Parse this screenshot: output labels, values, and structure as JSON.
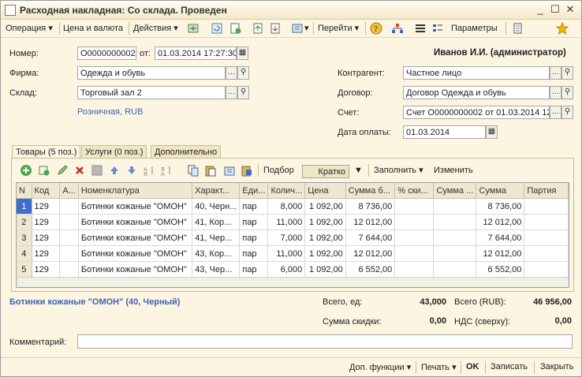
{
  "window": {
    "title": "Расходная накладная: Со склада. Проведен"
  },
  "toolbar": {
    "operation": "Операция",
    "price_currency": "Цена и валюта",
    "actions": "Действия",
    "goto": "Перейти",
    "params": "Параметры"
  },
  "header": {
    "number_label": "Номер:",
    "number_value": "О0000000002",
    "from_label": "от:",
    "date_value": "01.03.2014 17:27:30",
    "user": "Иванов И.И. (администратор)",
    "firm_label": "Фирма:",
    "firm_value": "Одежда и обувь",
    "warehouse_label": "Склад:",
    "warehouse_value": "Торговый зал 2",
    "price_type": "Розничная, RUB",
    "counterparty_label": "Контрагент:",
    "counterparty_value": "Частное лицо",
    "contract_label": "Договор:",
    "contract_value": "Договор Одежда и обувь",
    "invoice_label": "Счет:",
    "invoice_value": "Счет О0000000002 от 01.03.2014 12...",
    "paydate_label": "Дата оплаты:",
    "paydate_value": "01.03.2014"
  },
  "tabs": [
    "Товары (5 поз.)",
    "Услуги (0 поз.)",
    "Дополнительно"
  ],
  "grid_toolbar": {
    "pick": "Подбор",
    "mode": "Кратко",
    "fill": "Заполнить",
    "change": "Изменить"
  },
  "table": {
    "columns": [
      "N",
      "Код",
      "А...",
      "Номенклатура",
      "Характ...",
      "Еди...",
      "Колич...",
      "Цена",
      "Сумма б...",
      "% ски...",
      "Сумма ...",
      "Сумма",
      "Партия"
    ],
    "rows": [
      [
        "1",
        "129",
        "",
        "Ботинки кожаные \"ОМОН\"",
        "40, Черн...",
        "пар",
        "8,000",
        "1 092,00",
        "8 736,00",
        "",
        "",
        "8 736,00",
        ""
      ],
      [
        "2",
        "129",
        "",
        "Ботинки кожаные \"ОМОН\"",
        "41, Кор...",
        "пар",
        "11,000",
        "1 092,00",
        "12 012,00",
        "",
        "",
        "12 012,00",
        ""
      ],
      [
        "3",
        "129",
        "",
        "Ботинки кожаные \"ОМОН\"",
        "41, Чер...",
        "пар",
        "7,000",
        "1 092,00",
        "7 644,00",
        "",
        "",
        "7 644,00",
        ""
      ],
      [
        "4",
        "129",
        "",
        "Ботинки кожаные \"ОМОН\"",
        "43, Кор...",
        "пар",
        "11,000",
        "1 092,00",
        "12 012,00",
        "",
        "",
        "12 012,00",
        ""
      ],
      [
        "5",
        "129",
        "",
        "Ботинки кожаные \"ОМОН\"",
        "43, Чер...",
        "пар",
        "6,000",
        "1 092,00",
        "6 552,00",
        "",
        "",
        "6 552,00",
        ""
      ]
    ]
  },
  "summary": {
    "current_item": "Ботинки кожаные \"ОМОН\" (40, Черный)",
    "total_units_label": "Всего, ед:",
    "total_units": "43,000",
    "total_rub_label": "Всего (RUB):",
    "total_rub": "46 956,00",
    "discount_label": "Сумма скидки:",
    "discount": "0,00",
    "vat_label": "НДС (сверху):",
    "vat": "0,00"
  },
  "comment_label": "Комментарий:",
  "footer": {
    "extra": "Доп. функции",
    "print": "Печать",
    "ok": "OK",
    "save": "Записать",
    "close": "Закрыть"
  }
}
